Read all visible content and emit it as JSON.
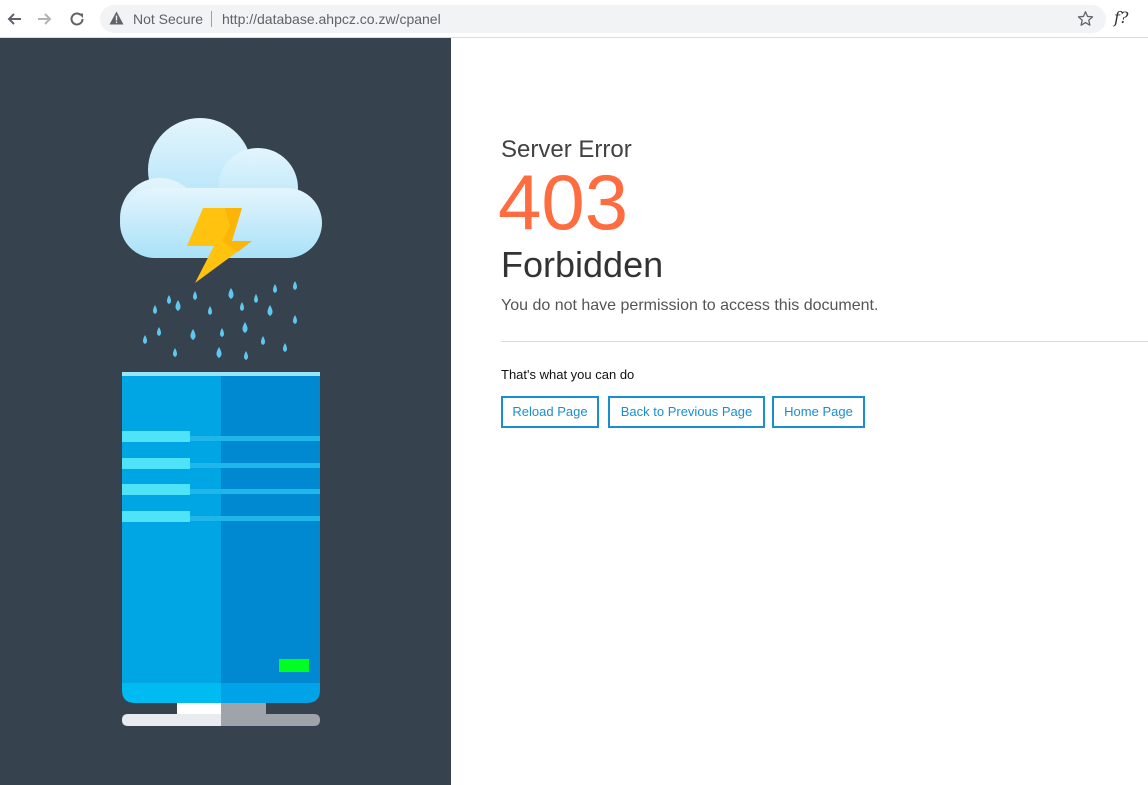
{
  "browser": {
    "security_label": "Not Secure",
    "url": "http://database.ahpcz.co.zw/cpanel",
    "extension_label": "f?"
  },
  "error": {
    "title": "Server Error",
    "code": "403",
    "status": "Forbidden",
    "message": "You do not have permission to access this document."
  },
  "actions": {
    "heading": "That's what you can do",
    "reload_label": "Reload Page",
    "back_label": "Back to Previous Page",
    "home_label": "Home Page"
  },
  "colors": {
    "panel": "#36434f",
    "accent": "#ff6c40",
    "link": "#1a8fd0",
    "server_light": "#00a5e3",
    "server_dark": "#0089d0",
    "bolt": "#ffc20e",
    "status_led": "#00ff21"
  },
  "icons": {
    "back": "arrow-left-icon",
    "forward": "arrow-right-icon",
    "reload": "reload-icon",
    "security": "warning-triangle-icon",
    "bookmark": "star-icon"
  }
}
